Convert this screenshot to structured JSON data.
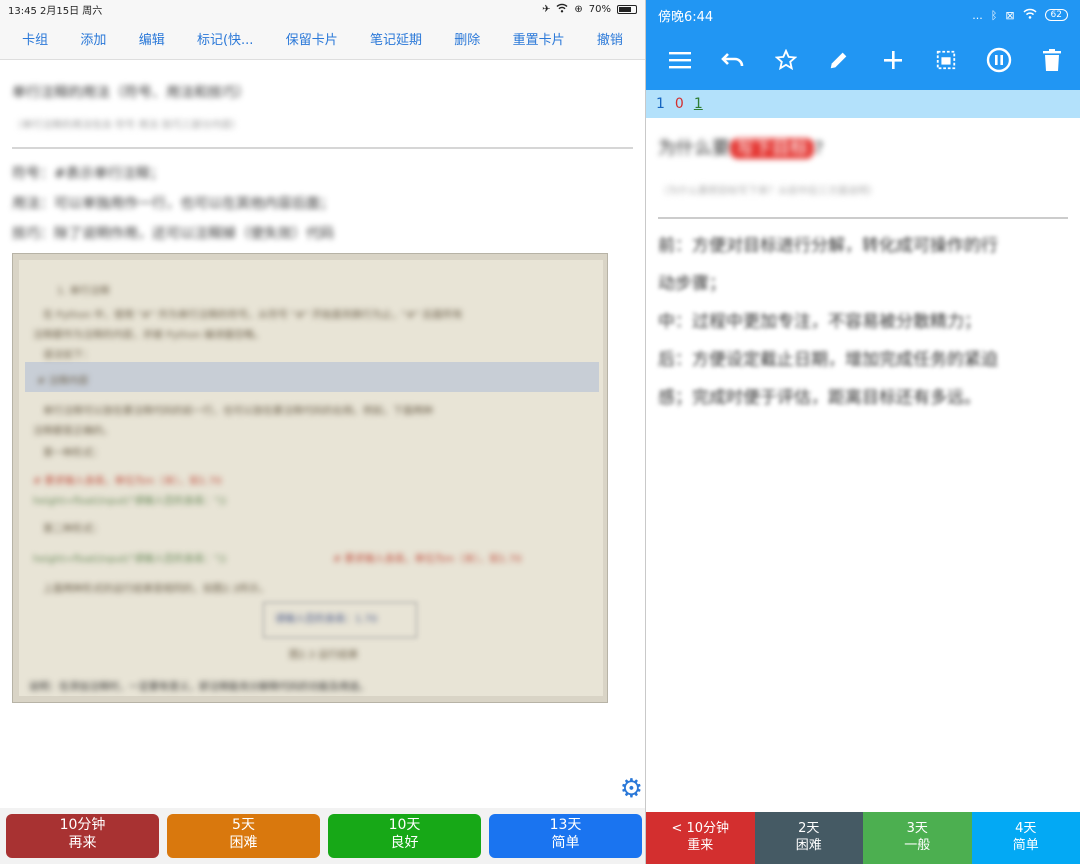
{
  "ios": {
    "status": {
      "time_date": "13:45  2月15日 周六",
      "battery": "70%"
    },
    "toolbar": [
      "卡组",
      "添加",
      "编辑",
      "标记(快...",
      "保留卡片",
      "笔记延期",
      "删除",
      "重置卡片",
      "撤销"
    ],
    "question": "单行注释的用法（符号、用法和技巧）",
    "question_sub": "（单行注释的用法包含 符号 用法 技巧三部分内容）",
    "answer_lines": [
      "符号：#表示单行注释；",
      "用法：可以单独用作一行，也可以在其他内容后面；",
      "技巧：除了说明作用，还可以注释掉（使失效）代码"
    ],
    "photo_lines": [
      "1. 单行注释",
      "在 Python 中，使用 \"#\" 作为单行注释的符号。从符号 \"#\" 开始直到换行为止，\"#\" 后面所有",
      "注释都作为注释的内容，并被 Python 编译器忽略。",
      "语法如下：",
      "# 注释内容",
      "单行注释可以放在要注释代码的前一行，也可以放在要注释代码的右侧。例如，下面两种",
      "注释都是正确的。",
      "第一种形式：",
      "# 要求输入身高，单位为m（米），如1.70",
      "height=float(input(\"请输入您的身高：\"))",
      "第二种形式：",
      "height=float(input(\"请输入您的身高：\"))",
      "# 要求输入身高，单位为m（米），如1.70",
      "上面两种形式的运行结果是相同的，如图2.3所示。",
      "请输入您的身高：1.70",
      "图2.3  运行结果",
      "说明：在添加注释时，一定要有意义，即注释能充分解释代码的功能及用途。"
    ],
    "answer_buttons": [
      {
        "line1": "10分钟",
        "line2": "再来",
        "color": "#a83232"
      },
      {
        "line1": "5天",
        "line2": "困难",
        "color": "#d9780d"
      },
      {
        "line1": "10天",
        "line2": "良好",
        "color": "#17a817"
      },
      {
        "line1": "13天",
        "line2": "简单",
        "color": "#1a74f0"
      }
    ]
  },
  "android": {
    "status": {
      "time": "傍晚6:44",
      "signal": "...",
      "battery": "62"
    },
    "counts": [
      {
        "value": "1",
        "color": "#1565c0"
      },
      {
        "value": "0",
        "color": "#d32f2f"
      },
      {
        "value": "1",
        "color": "#2e7d32"
      }
    ],
    "question_prefix": "为什么要",
    "question_highlight": "写下目标",
    "question_suffix": "?",
    "question_sub": "（为什么要把目标写下来？从前中后三方面说明）",
    "answer_lines": [
      "前：方便对目标进行分解，转化成可操作的行",
      "动步骤；",
      "中：过程中更加专注，不容易被分散精力；",
      "后：方便设定截止日期，增加完成任务的紧迫",
      "感；完成时便于评估，距离目标还有多远。"
    ],
    "answer_buttons": [
      {
        "line1": "< 10分钟",
        "line2": "重来",
        "color": "#d32f2f"
      },
      {
        "line1": "2天",
        "line2": "困难",
        "color": "#455a64"
      },
      {
        "line1": "3天",
        "line2": "一般",
        "color": "#4caf50"
      },
      {
        "line1": "4天",
        "line2": "简单",
        "color": "#03a9f4"
      }
    ]
  }
}
